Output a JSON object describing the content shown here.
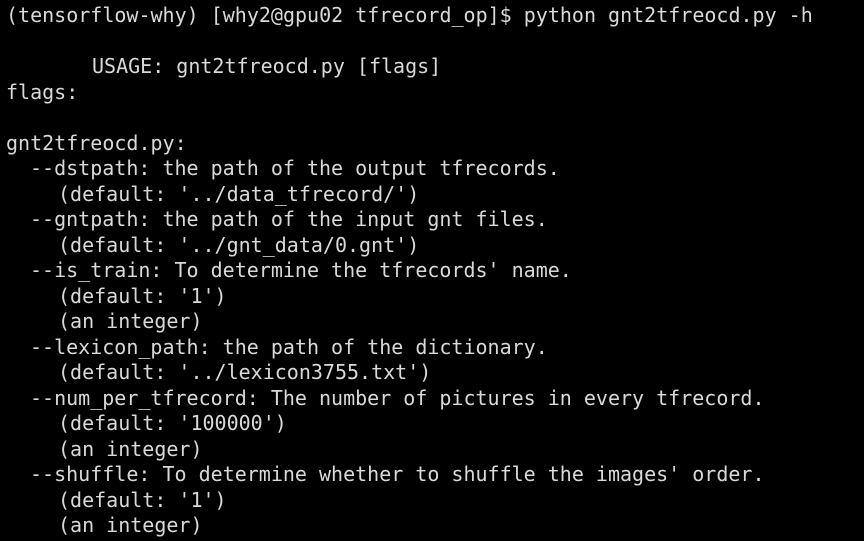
{
  "terminal": {
    "text_color": "#d9d9d9",
    "background": "#000000",
    "prompt_line": "(tensorflow-why) [why2@gpu02 tfrecord_op]$ python gnt2tfreocd.py -h",
    "usage_line": "USAGE: gnt2tfreocd.py [flags]",
    "flags_header": "flags:",
    "module_header": "gnt2tfreocd.py:",
    "flags": [
      {
        "description": "--dstpath: the path of the output tfrecords.",
        "default": "(default: '../data_tfrecord/')",
        "type_note": ""
      },
      {
        "description": "--gntpath: the path of the input gnt files.",
        "default": "(default: '../gnt_data/0.gnt')",
        "type_note": ""
      },
      {
        "description": "--is_train: To determine the tfrecords' name.",
        "default": "(default: '1')",
        "type_note": "(an integer)"
      },
      {
        "description": "--lexicon_path: the path of the dictionary.",
        "default": "(default: '../lexicon3755.txt')",
        "type_note": ""
      },
      {
        "description": "--num_per_tfrecord: The number of pictures in every tfrecord.",
        "default": "(default: '100000')",
        "type_note": "(an integer)"
      },
      {
        "description": "--shuffle: To determine whether to shuffle the images' order.",
        "default": "(default: '1')",
        "type_note": "(an integer)"
      }
    ]
  }
}
